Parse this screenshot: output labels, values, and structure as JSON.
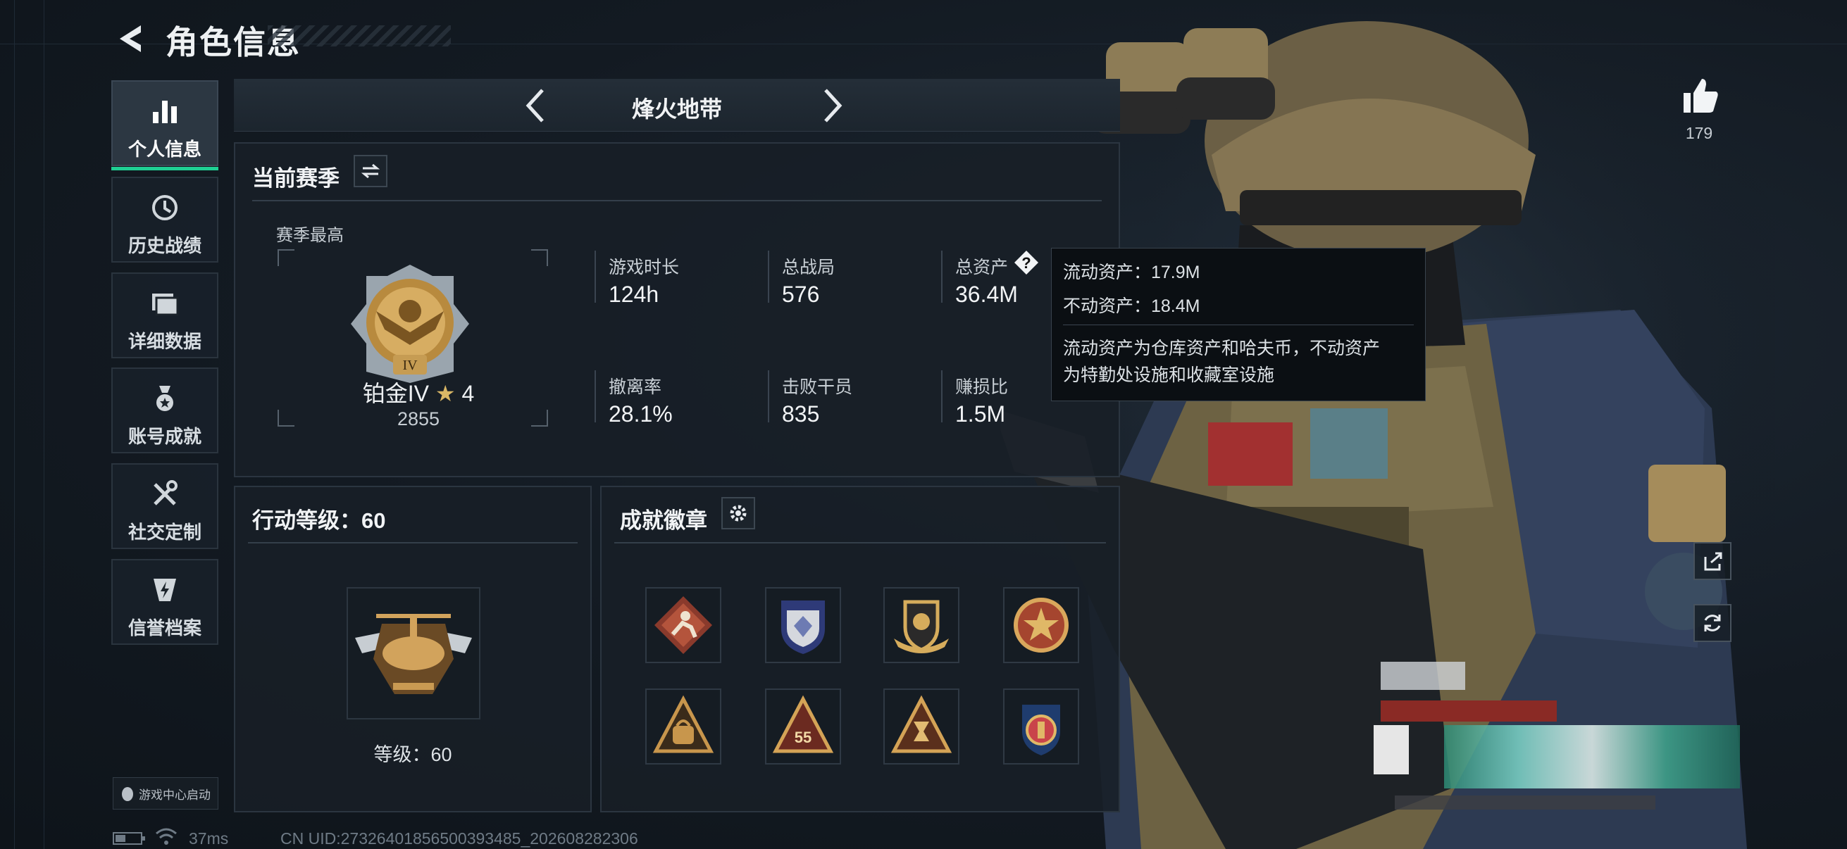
{
  "header": {
    "title": "角色信息"
  },
  "sidebar": {
    "items": [
      {
        "label": "个人信息",
        "icon": "bar-chart-icon",
        "active": true
      },
      {
        "label": "历史战绩",
        "icon": "clock-history-icon",
        "active": false
      },
      {
        "label": "详细数据",
        "icon": "folder-icon",
        "active": false
      },
      {
        "label": "账号成就",
        "icon": "medal-icon",
        "active": false
      },
      {
        "label": "社交定制",
        "icon": "tools-icon",
        "active": false
      },
      {
        "label": "信誉档案",
        "icon": "shield-bolt-icon",
        "active": false
      }
    ],
    "game_center": "游戏中心启动"
  },
  "mode": {
    "title": "烽火地带"
  },
  "season": {
    "title": "当前赛季",
    "best_label": "赛季最高",
    "rank_name": "铂金IV",
    "rank_stars": "4",
    "rank_points": "2855",
    "rank_emblem_text": "IV",
    "stats": [
      {
        "label": "游戏时长",
        "value": "124h"
      },
      {
        "label": "总战局",
        "value": "576"
      },
      {
        "label": "总资产",
        "value": "36.4M"
      },
      {
        "label": "撤离率",
        "value": "28.1%"
      },
      {
        "label": "击败干员",
        "value": "835"
      },
      {
        "label": "赚损比",
        "value": "1.5M"
      }
    ]
  },
  "tooltip": {
    "liquid": "流动资产：17.9M",
    "fixed": "不动资产：18.4M",
    "note_line1": "流动资产为仓库资产和哈夫币，不动资产",
    "note_line2": "为特勤处设施和收藏室设施"
  },
  "level": {
    "title": "行动等级：60",
    "level_text": "等级：60"
  },
  "achievements": {
    "title": "成就徽章",
    "badges": [
      "runner-badge-icon",
      "shield-gem-badge-icon",
      "winged-shield-badge-icon",
      "star-badge-icon",
      "bag-badge-icon",
      "55-triangle-badge-icon",
      "hourglass-badge-icon",
      "round-shield-badge-icon"
    ],
    "badge_55_text": "55"
  },
  "likes": {
    "count": "179"
  },
  "footer": {
    "ping": "37ms",
    "uid": "CN UID:27326401856500393485_202608282306"
  },
  "colors": {
    "accent_green": "#1fcf93",
    "gold": "#c8a15a",
    "background": "#131a22"
  }
}
